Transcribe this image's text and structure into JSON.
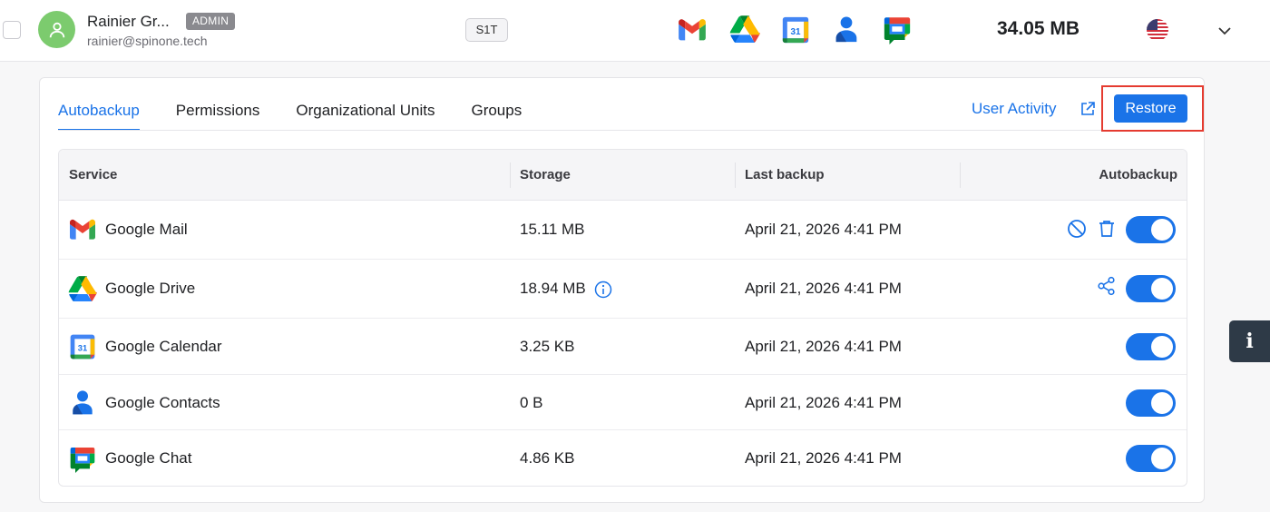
{
  "user": {
    "name": "Rainier Gr...",
    "role": "ADMIN",
    "email": "rainier@spinone.tech",
    "tier": "S1T",
    "services": [
      "gmail-icon",
      "google-drive-icon",
      "google-calendar-icon",
      "google-contacts-icon",
      "google-chat-icon"
    ],
    "total_size": "34.05 MB",
    "region": "us-flag-icon"
  },
  "tabs": [
    "Autobackup",
    "Permissions",
    "Organizational Units",
    "Groups"
  ],
  "active_tab": "Autobackup",
  "header_actions": {
    "user_activity": "User Activity",
    "restore": "Restore"
  },
  "table": {
    "columns": [
      "Service",
      "Storage",
      "Last backup",
      "Autobackup"
    ],
    "rows": [
      {
        "service": "Google Mail",
        "icon": "gmail-icon",
        "storage": "15.11 MB",
        "last_backup": "April 21, 2026 4:41 PM",
        "autobackup": true,
        "actions": [
          "block-icon",
          "trash-icon"
        ]
      },
      {
        "service": "Google Drive",
        "icon": "google-drive-icon",
        "storage": "18.94 MB",
        "last_backup": "April 21, 2026 4:41 PM",
        "autobackup": true,
        "actions": [
          "share-icon"
        ],
        "storage_info": true
      },
      {
        "service": "Google Calendar",
        "icon": "google-calendar-icon",
        "storage": "3.25 KB",
        "last_backup": "April 21, 2026 4:41 PM",
        "autobackup": true,
        "actions": []
      },
      {
        "service": "Google Contacts",
        "icon": "google-contacts-icon",
        "storage": "0 B",
        "last_backup": "April 21, 2026 4:41 PM",
        "autobackup": true,
        "actions": []
      },
      {
        "service": "Google Chat",
        "icon": "google-chat-icon",
        "storage": "4.86 KB",
        "last_backup": "April 21, 2026 4:41 PM",
        "autobackup": true,
        "actions": []
      }
    ]
  },
  "colors": {
    "accent": "#1a73e8",
    "highlight": "#e53b30",
    "avatar": "#7ccb6e"
  },
  "side_panel_icon": "info-icon"
}
